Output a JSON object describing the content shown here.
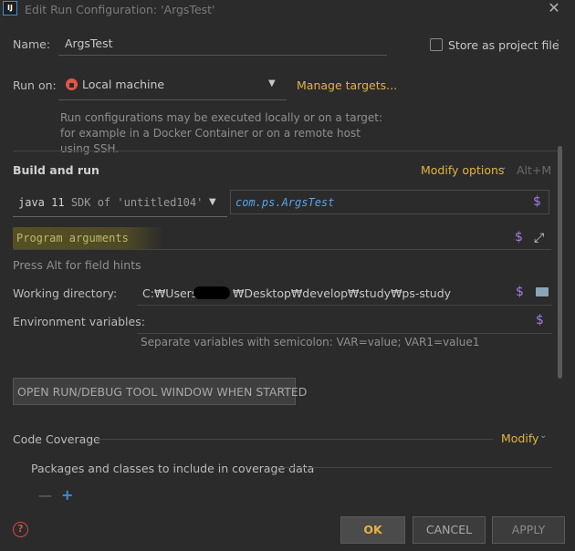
{
  "window": {
    "app_icon_text": "IJ",
    "title": "Edit Run Configuration: 'ArgsTest'",
    "close_glyph": "✕"
  },
  "name": {
    "label": "Name:",
    "value": "ArgsTest"
  },
  "store_as_project_file": {
    "label": "Store as project file",
    "checked": false
  },
  "run_on": {
    "label": "Run on:",
    "value": "Local machine",
    "manage_targets": "Manage targets...",
    "help": "Run configurations may be executed locally or on a target: for example in a Docker Container or on a remote host using SSH."
  },
  "build_and_run": {
    "heading": "Build and run",
    "modify_options": "Modify options",
    "modify_shortcut": "Alt+M",
    "jre": {
      "version": "java 11",
      "sdk": "SDK of 'untitled104'"
    },
    "main_class": "com.ps.ArgsTest",
    "program_arguments_placeholder": "Program arguments",
    "field_hint": "Press Alt for field hints"
  },
  "working_directory": {
    "label": "Working directory:",
    "value_prefix": "C:₩Users₩",
    "value_suffix": "₩Desktop₩develop₩study₩ps-study"
  },
  "environment_variables": {
    "label": "Environment variables:",
    "value": "",
    "hint": "Separate variables with semicolon: VAR=value; VAR1=value1"
  },
  "open_tool_window_button": "OPEN RUN/DEBUG TOOL WINDOW WHEN STARTED",
  "code_coverage": {
    "label": "Code Coverage",
    "modify": "Modify",
    "packages_label": "Packages and classes to include in coverage data"
  },
  "icons": {
    "dollar": "$",
    "expand": "⤢",
    "minus": "—",
    "plus": "+",
    "help": "?",
    "caret": "▼",
    "chevron": "⌄"
  },
  "footer": {
    "ok": "OK",
    "cancel": "CANCEL",
    "apply": "APPLY"
  },
  "colors": {
    "background": "#2b2b2b",
    "accent_link": "#e3b341",
    "variable_icon": "#a07ce2",
    "main_class_text": "#5aa2e6"
  }
}
